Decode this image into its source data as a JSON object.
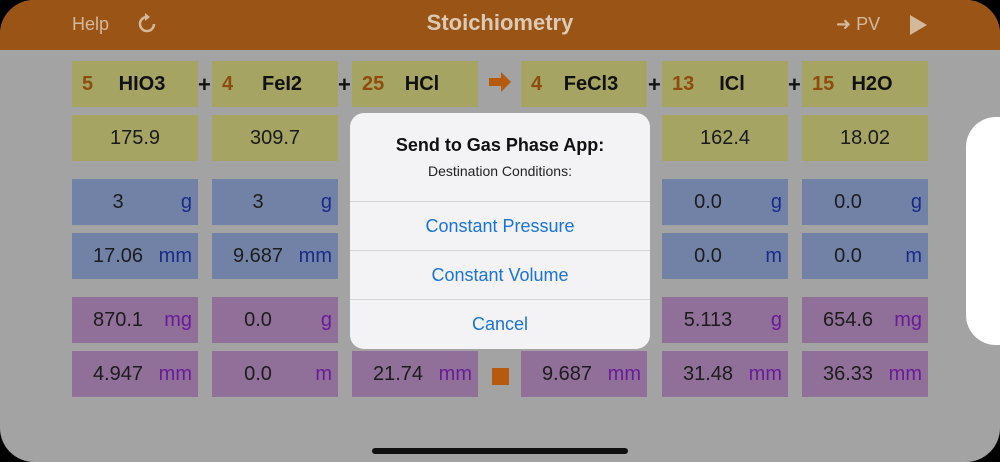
{
  "nav": {
    "help": "Help",
    "title": "Stoichiometry",
    "pv": "PV",
    "pv_arrow": "➜"
  },
  "equation": {
    "r1": {
      "coef": "5",
      "formula": "HIO3"
    },
    "r2": {
      "coef": "4",
      "formula": "FeI2"
    },
    "r3": {
      "coef": "25",
      "formula": "HCl"
    },
    "p1": {
      "coef": "4",
      "formula": "FeCl3"
    },
    "p2": {
      "coef": "13",
      "formula": "ICl"
    },
    "p3": {
      "coef": "15",
      "formula": "H2O"
    },
    "plus": "+"
  },
  "molar_mass": {
    "r1": "175.9",
    "r2": "309.7",
    "p2": "162.4",
    "p3": "18.02"
  },
  "mass_input": {
    "r1": {
      "value": "3",
      "unit": "g"
    },
    "r2": {
      "value": "3",
      "unit": "g"
    },
    "p2": {
      "value": "0.0",
      "unit": "g"
    },
    "p3": {
      "value": "0.0",
      "unit": "g"
    }
  },
  "moles_input": {
    "r1": {
      "value": "17.06",
      "unit": "mm"
    },
    "r2": {
      "value": "9.687",
      "unit": "mm"
    },
    "p2": {
      "value": "0.0",
      "unit": "m"
    },
    "p3": {
      "value": "0.0",
      "unit": "m"
    }
  },
  "mass_result": {
    "r1": {
      "value": "870.1",
      "unit": "mg"
    },
    "r2": {
      "value": "0.0",
      "unit": "g"
    },
    "p2": {
      "value": "5.113",
      "unit": "g"
    },
    "p3": {
      "value": "654.6",
      "unit": "mg"
    }
  },
  "moles_result": {
    "r1": {
      "value": "4.947",
      "unit": "mm"
    },
    "r2": {
      "value": "0.0",
      "unit": "m"
    },
    "r3": {
      "value": "21.74",
      "unit": "mm"
    },
    "p1": {
      "value": "9.687",
      "unit": "mm"
    },
    "p2": {
      "value": "31.48",
      "unit": "mm"
    },
    "p3": {
      "value": "36.33",
      "unit": "mm"
    }
  },
  "dialog": {
    "title": "Send to Gas Phase App:",
    "subtitle": "Destination Conditions:",
    "option1": "Constant Pressure",
    "option2": "Constant Volume",
    "cancel": "Cancel"
  },
  "colors": {
    "nav": "#9a5516",
    "accent": "#b45b10",
    "link": "#1a73d6"
  }
}
